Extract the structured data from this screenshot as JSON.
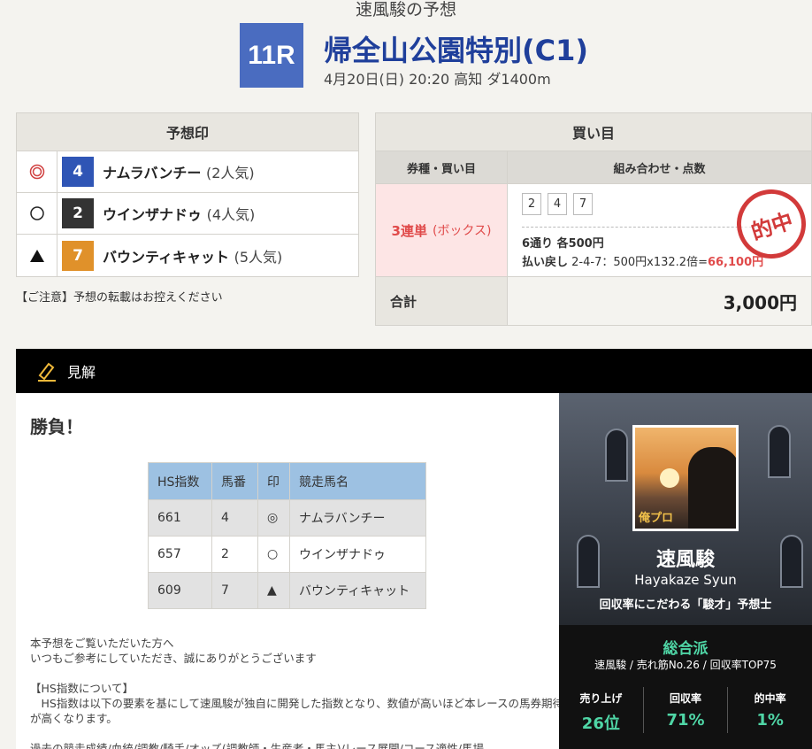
{
  "header": {
    "subtitle": "速風駿の予想",
    "race_no": "11R",
    "race_name": "帰全山公園特別(C1)",
    "race_info": "4月20日(日) 20:20 高知 ダ1400m"
  },
  "marks": {
    "title": "予想印",
    "rows": [
      {
        "symbol": "◎",
        "num": "4",
        "color": "#2f55b5",
        "name": "ナムラバンチー",
        "pop": "(2人気)"
      },
      {
        "symbol": "○",
        "num": "2",
        "color": "#333333",
        "name": "ウインザナドゥ",
        "pop": "(4人気)"
      },
      {
        "symbol": "▲",
        "num": "7",
        "color": "#e0912a",
        "name": "バウンティキャット",
        "pop": "(5人気)"
      }
    ],
    "note": "【ご注意】予想の転載はお控えください"
  },
  "bets": {
    "title": "買い目",
    "col1": "券種・買い目",
    "col2": "組み合わせ・点数",
    "bet_type": "3連単",
    "bet_mode": "(ボックス)",
    "chips": [
      "2",
      "4",
      "7"
    ],
    "count": "6通り 各500円",
    "payout_label": "払い戻し",
    "payout_detail": " 2-4-7：500円x132.2倍=",
    "payout_amount": "66,100円",
    "stamp": "的中",
    "total_label": "合計",
    "total_value": "3,000円"
  },
  "opinion": {
    "label": "見解",
    "headline": "勝負！",
    "table_headers": [
      "HS指数",
      "馬番",
      "印",
      "競走馬名"
    ],
    "table_rows": [
      [
        "661",
        "4",
        "◎",
        "ナムラバンチー"
      ],
      [
        "657",
        "2",
        "○",
        "ウインザナドゥ"
      ],
      [
        "609",
        "7",
        "▲",
        "バウンティキャット"
      ]
    ],
    "text1": "本予想をご覧いただいた方へ",
    "text2": "いつもご参考にしていただき、誠にありがとうございます",
    "text3": "【HS指数について】",
    "text4": "　HS指数は以下の要素を基にして速風駿が独自に開発した指数となり、数値が高いほど本レースの馬券期待値",
    "text5": "が高くなります。",
    "text6": "過去の競走成績/血統/調教/騎手/オッズ(調教師・生産者・馬主)/レース展開/コース適性/馬場..."
  },
  "profile": {
    "name": "速風駿",
    "roman": "Hayakaze Syun",
    "tagline": "回収率にこだわる「駿才」予想士",
    "photo_badge": "俺プロ",
    "type": "総合派",
    "desc": "速風駿 / 売れ筋No.26 / 回収率TOP75",
    "stats": [
      {
        "label": "売り上げ",
        "value": "26位"
      },
      {
        "label": "回収率",
        "value": "71%"
      },
      {
        "label": "的中率",
        "value": "1%"
      }
    ]
  }
}
